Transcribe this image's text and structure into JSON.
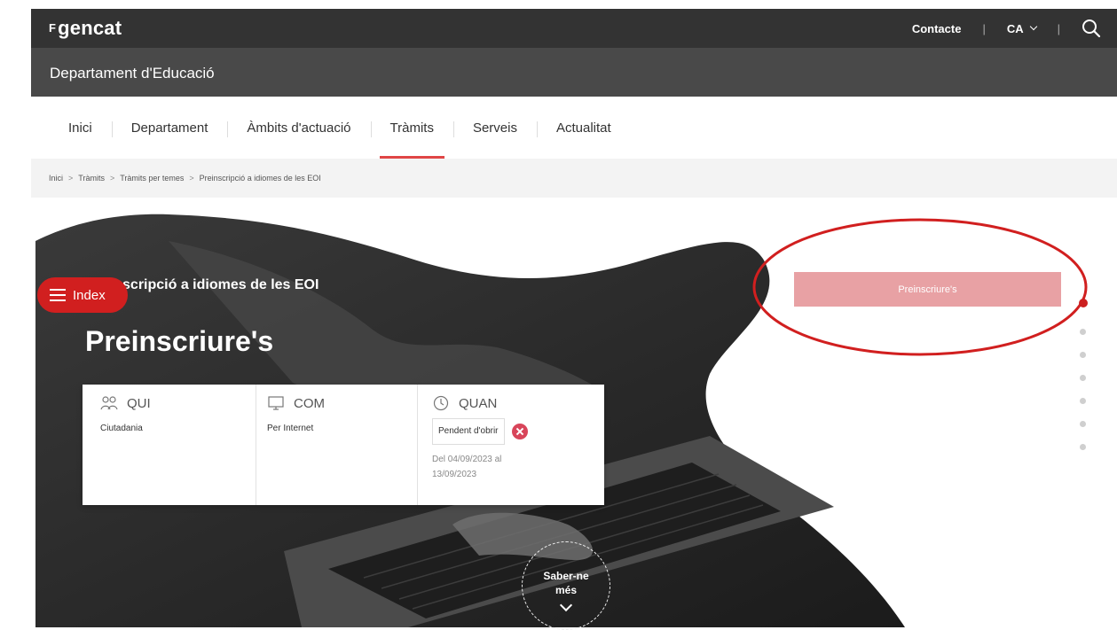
{
  "header": {
    "logo": "gencat",
    "contact_label": "Contacte",
    "lang_label": "CA",
    "department": "Departament d'Educació"
  },
  "nav": {
    "items": [
      "Inici",
      "Departament",
      "Àmbits d'actuació",
      "Tràmits",
      "Serveis",
      "Actualitat"
    ],
    "active": "Tràmits"
  },
  "breadcrumb": {
    "items": [
      "Inici",
      "Tràmits",
      "Tràmits per temes",
      "Preinscripció a idiomes de les EOI"
    ]
  },
  "hero": {
    "subtitle": "Preinscripció a idiomes de les EOI",
    "title": "Preinscriure's",
    "index_label": "Index",
    "cta_label": "Preinscriure's",
    "more_label_1": "Saber-ne",
    "more_label_2": "més"
  },
  "info": {
    "qui_label": "QUI",
    "qui_value": "Ciutadania",
    "com_label": "COM",
    "com_value": "Per Internet",
    "quan_label": "QUAN",
    "status": "Pendent d'obrir",
    "date_range": "Del 04/09/2023 al 13/09/2023"
  },
  "colors": {
    "accent": "#d11f1f",
    "cta_disabled": "#e8a1a4",
    "annotation": "#d11f1f"
  }
}
